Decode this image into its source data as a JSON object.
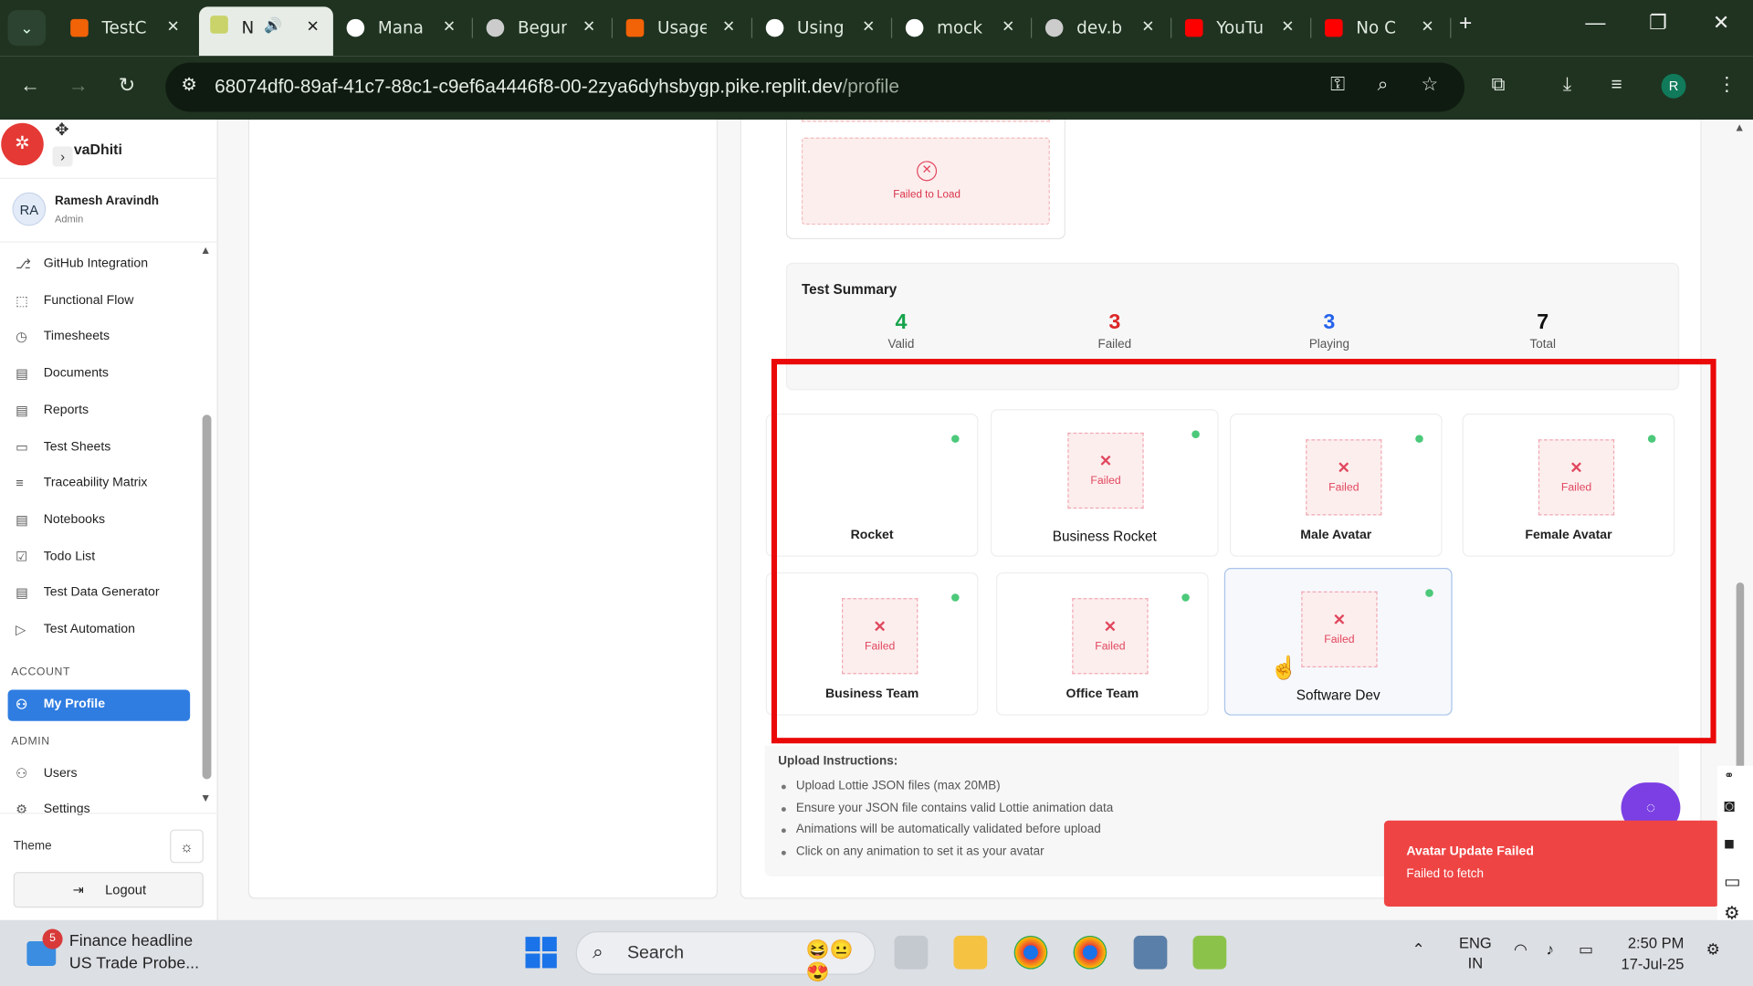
{
  "browser": {
    "tabs": [
      {
        "title": "TestC",
        "icon": "replit-icon",
        "color": "#f26207"
      },
      {
        "title": "N",
        "icon": "app-favicon",
        "color": "#c9d36a",
        "active": true,
        "audio": "speaker-icon"
      },
      {
        "title": "Mana",
        "icon": "github-icon",
        "color": "#ffffff"
      },
      {
        "title": "Begur",
        "icon": "globe-icon",
        "color": "#cccccc"
      },
      {
        "title": "Usage",
        "icon": "replit-icon",
        "color": "#f26207"
      },
      {
        "title": "Using",
        "icon": "openai-icon",
        "color": "#ffffff"
      },
      {
        "title": "mock",
        "icon": "google-icon",
        "color": "#ffffff"
      },
      {
        "title": "dev.b",
        "icon": "globe-icon",
        "color": "#cccccc"
      },
      {
        "title": "YouTu",
        "icon": "youtube-icon",
        "color": "#ff0000"
      },
      {
        "title": "No C",
        "icon": "youtube-icon",
        "color": "#ff0000"
      }
    ],
    "url_main": "68074df0-89af-41c7-88c1-c9ef6a4446f8-00-2zya6dyhsbygp.pike.replit.dev",
    "url_path": "/profile",
    "profile_initial": "R"
  },
  "sidebar": {
    "brand": "vaDhiti",
    "user_initials": "RA",
    "user_name": "Ramesh Aravindh",
    "user_role": "Admin",
    "nav_items": [
      {
        "label": "GitHub Integration",
        "icon": "github-icon"
      },
      {
        "label": "Functional Flow",
        "icon": "flow-icon"
      },
      {
        "label": "Timesheets",
        "icon": "clock-icon"
      },
      {
        "label": "Documents",
        "icon": "document-icon"
      },
      {
        "label": "Reports",
        "icon": "report-icon"
      },
      {
        "label": "Test Sheets",
        "icon": "sheet-icon"
      },
      {
        "label": "Traceability Matrix",
        "icon": "matrix-icon"
      },
      {
        "label": "Notebooks",
        "icon": "notebook-icon"
      },
      {
        "label": "Todo List",
        "icon": "checkbox-icon"
      },
      {
        "label": "Test Data Generator",
        "icon": "generator-icon"
      },
      {
        "label": "Test Automation",
        "icon": "play-icon"
      }
    ],
    "section_account": "ACCOUNT",
    "my_profile": "My Profile",
    "section_admin": "ADMIN",
    "users": "Users",
    "settings": "Settings",
    "theme_label": "Theme",
    "logout": "Logout"
  },
  "main": {
    "top_fail_text": "Failed to Load",
    "summary_title": "Test Summary",
    "stats": [
      {
        "value": "4",
        "label": "Valid",
        "color": "#16a34a"
      },
      {
        "value": "3",
        "label": "Failed",
        "color": "#dc2626"
      },
      {
        "value": "3",
        "label": "Playing",
        "color": "#2563eb"
      },
      {
        "value": "7",
        "label": "Total",
        "color": "#111111"
      }
    ],
    "animations": [
      {
        "name": "Rocket",
        "failed": false
      },
      {
        "name": "Business Rocket",
        "failed": true
      },
      {
        "name": "Male Avatar",
        "failed": true
      },
      {
        "name": "Female Avatar",
        "failed": true
      },
      {
        "name": "Business Team",
        "failed": true
      },
      {
        "name": "Office Team",
        "failed": true
      },
      {
        "name": "Software Dev",
        "failed": true,
        "selected": true
      }
    ],
    "failed_label": "Failed",
    "instructions_title": "Upload Instructions:",
    "instructions": [
      "Upload Lottie JSON files (max 20MB)",
      "Ensure your JSON file contains valid Lottie animation data",
      "Animations will be automatically validated before upload",
      "Click on any animation to set it as your avatar"
    ]
  },
  "toast": {
    "title": "Avatar Update Failed",
    "message": "Failed to fetch"
  },
  "taskbar": {
    "news_badge": "5",
    "news_title": "Finance headline",
    "news_sub": "US Trade Probe...",
    "search_label": "Search",
    "lang_1": "ENG",
    "lang_2": "IN",
    "time": "2:50 PM",
    "date": "17-Jul-25"
  }
}
